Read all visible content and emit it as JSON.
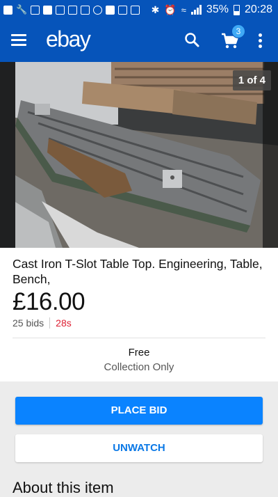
{
  "status_bar": {
    "battery": "35%",
    "time": "20:28",
    "battery_level": 0.35
  },
  "app_bar": {
    "logo": "ebay",
    "cart_count": "3"
  },
  "listing": {
    "image_counter": "1 of 4",
    "title": "Cast Iron T-Slot Table Top. Engineering, Table, Bench,",
    "price": "£16.00",
    "bids": "25 bids",
    "time_left": "28s",
    "shipping_cost": "Free",
    "shipping_method": "Collection Only"
  },
  "actions": {
    "place_bid": "PLACE BID",
    "unwatch": "UNWATCH"
  },
  "section": {
    "about": "About this item"
  },
  "colors": {
    "brand_blue": "#0654ba",
    "button_blue": "#0a83ff",
    "time_red": "#dd1e31"
  }
}
